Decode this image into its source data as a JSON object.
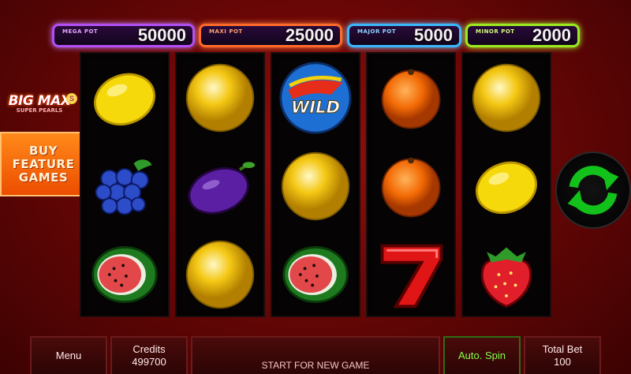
{
  "jackpots": [
    {
      "label": "MEGA POT",
      "value": "50000"
    },
    {
      "label": "MAXI POT",
      "value": "25000"
    },
    {
      "label": "MAJOR POT",
      "value": "5000"
    },
    {
      "label": "MINOR POT",
      "value": "2000"
    }
  ],
  "logo": {
    "title": "BIG MAX",
    "subtitle": "SUPER PEARLS",
    "badge": "S"
  },
  "buy_feature": {
    "label": "BUY\nFEATURE\nGAMES"
  },
  "reels": [
    [
      "lemon",
      "grapes",
      "watermelon"
    ],
    [
      "golden-pearl",
      "plum",
      "golden-pearl"
    ],
    [
      "wild",
      "golden-pearl",
      "watermelon"
    ],
    [
      "orange",
      "orange",
      "seven"
    ],
    [
      "golden-pearl",
      "lemon",
      "strawberry"
    ]
  ],
  "wild_text": "WILD",
  "spin_button": {
    "icon": "refresh-arrows-icon",
    "color": "#12c21b"
  },
  "bottom_bar": {
    "menu": "Menu",
    "credits_label": "Credits",
    "credits_value": "499700",
    "start": "START FOR NEW GAME",
    "auto_spin": "Auto. Spin",
    "total_bet_label": "Total Bet",
    "total_bet_value": "100"
  },
  "colors": {
    "background": "#7a0808",
    "mega": "#b24ff5",
    "maxi": "#ff6a2a",
    "major": "#3bb7ff",
    "minor": "#9bea1f",
    "buy_feature": "#f26a0c"
  }
}
